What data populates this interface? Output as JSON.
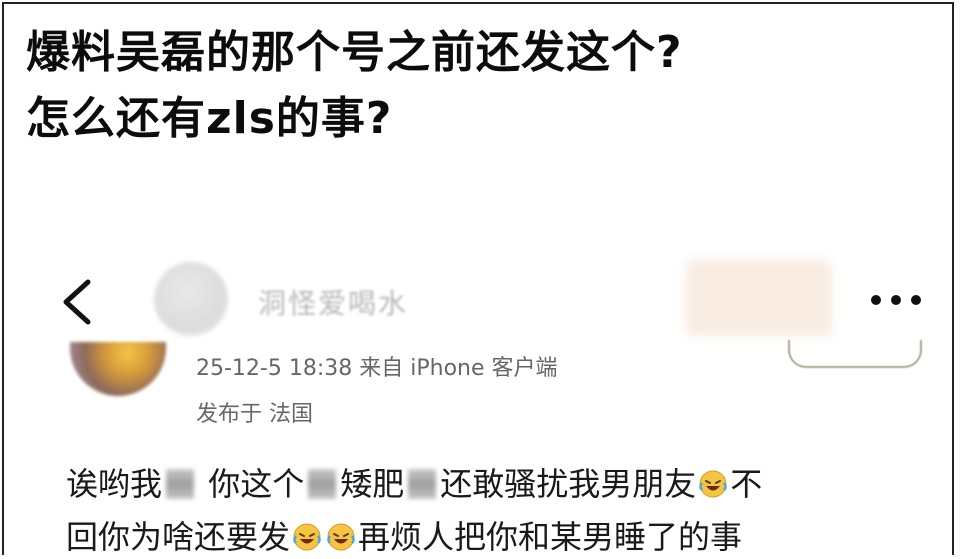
{
  "caption": {
    "line1": "爆料吴磊的那个号之前还发这个?",
    "line2": "怎么还有zls的事?"
  },
  "post": {
    "header_name": "洞怪爱喝水",
    "icons": {
      "back": "chevron-left-icon",
      "more": "more-dots-icon",
      "emoji": "laughing-crying-emoji"
    },
    "meta": {
      "time": "25-12-5 18:38 来自 iPhone 客户端",
      "location": "发布于 法国"
    },
    "body": {
      "seg1": "诶哟我",
      "seg2": " 你这个",
      "seg3": "矮肥",
      "seg4": "还敢骚扰我男朋友",
      "seg5": "不",
      "seg6": "回你为啥还要发",
      "seg7": "再烦人把你和某男睡了的事"
    }
  }
}
